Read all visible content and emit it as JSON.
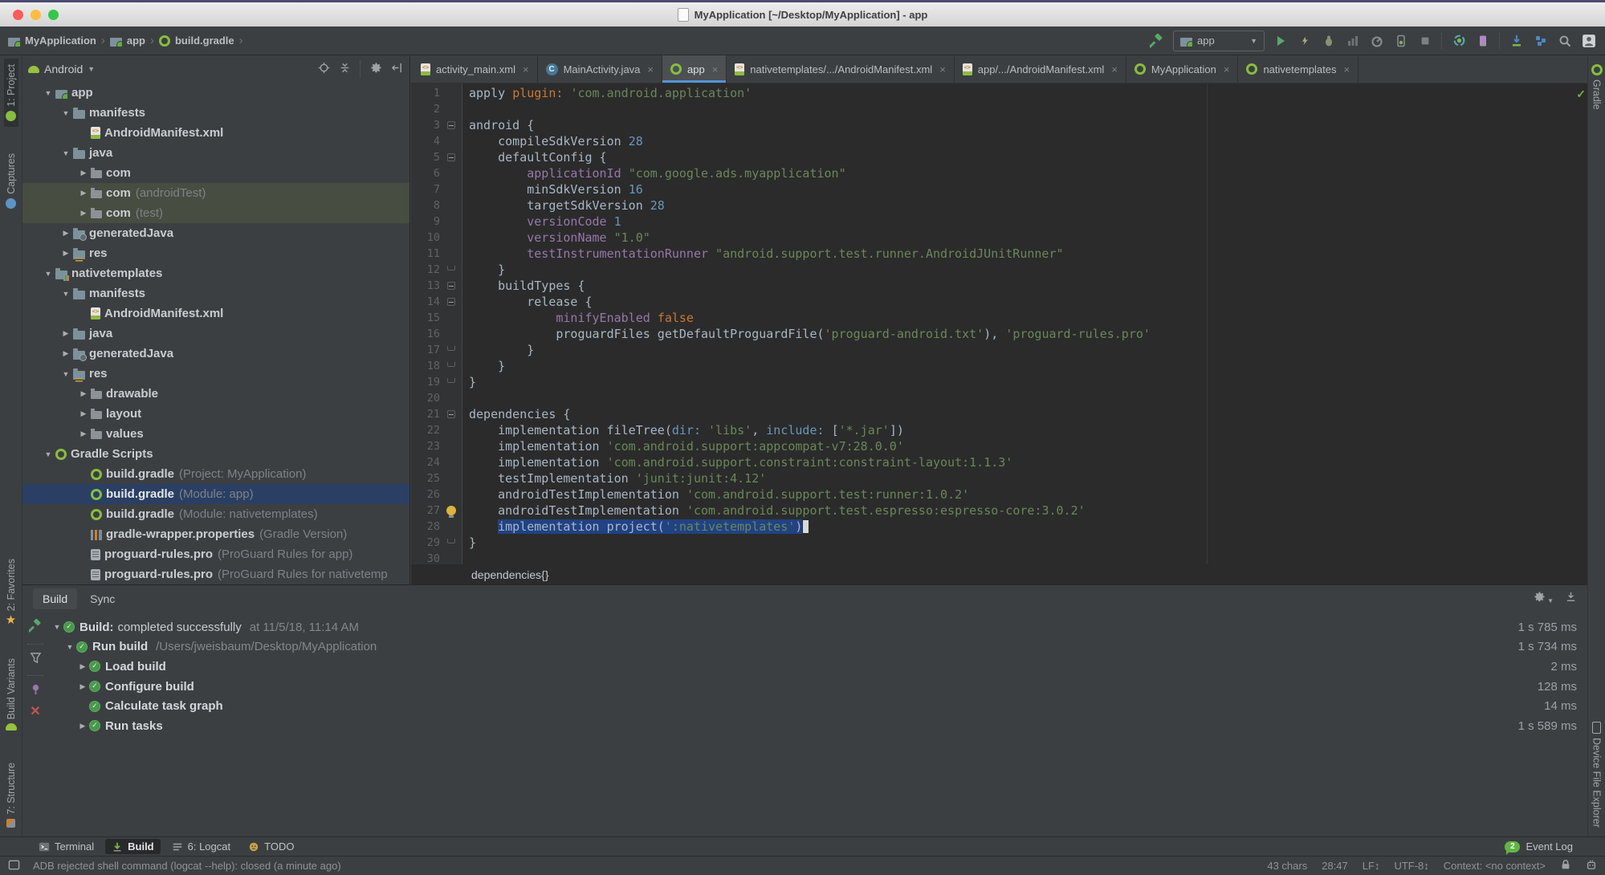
{
  "palette": {
    "chrome": "#3c3f41",
    "editor_bg": "#2b2b2b",
    "selection": "#214283",
    "tree_selection": "#2a3f63",
    "tab_underline": "#5394d6",
    "run_green": "#59a869",
    "gradle_green": "#87bd40",
    "error_red": "#c75450",
    "string_green": "#6a8759",
    "number_blue": "#6897bb",
    "keyword_orange": "#cc7832",
    "ident_purple": "#9876aa",
    "badge_green": "#62b543",
    "star_yellow": "#e8b64c"
  },
  "window": {
    "title": "MyApplication [~/Desktop/MyApplication] - app"
  },
  "breadcrumbs": [
    {
      "label": "MyApplication",
      "icon": "folder-icon"
    },
    {
      "label": "app",
      "icon": "module-folder-icon"
    },
    {
      "label": "build.gradle",
      "icon": "gradle-icon"
    }
  ],
  "toolbar": {
    "run_config": "app"
  },
  "stripes": {
    "left_top": [
      {
        "label": "1: Project",
        "icon": "project-icon"
      },
      {
        "label": "Captures",
        "icon": "captures-icon"
      }
    ],
    "left_bottom": [
      {
        "label": "2: Favorites",
        "icon": "star-icon"
      },
      {
        "label": "Build Variants",
        "icon": "android-icon"
      },
      {
        "label": "7: Structure",
        "icon": "structure-icon"
      }
    ],
    "right_top": {
      "label": "Gradle",
      "icon": "gradle-icon"
    },
    "right_bottom": {
      "label": "Device File Explorer",
      "icon": "phone-icon"
    }
  },
  "project": {
    "view": "Android",
    "tree": [
      {
        "d": 0,
        "a": "v",
        "i": "folder-app",
        "l": "app"
      },
      {
        "d": 1,
        "a": "v",
        "i": "folder",
        "l": "manifests"
      },
      {
        "d": 2,
        "a": "",
        "i": "manifest",
        "l": "AndroidManifest.xml"
      },
      {
        "d": 1,
        "a": "v",
        "i": "folder",
        "l": "java"
      },
      {
        "d": 2,
        "a": ">",
        "i": "pkg",
        "l": "com"
      },
      {
        "d": 2,
        "a": ">",
        "i": "pkg",
        "l": "com",
        "s": "(androidTest)",
        "hl": "soft"
      },
      {
        "d": 2,
        "a": ">",
        "i": "pkg",
        "l": "com",
        "s": "(test)",
        "hl": "soft"
      },
      {
        "d": 1,
        "a": ">",
        "i": "folder-gen",
        "l": "generatedJava"
      },
      {
        "d": 1,
        "a": ">",
        "i": "folder-res",
        "l": "res"
      },
      {
        "d": 0,
        "a": "v",
        "i": "folder-mod",
        "l": "nativetemplates"
      },
      {
        "d": 1,
        "a": "v",
        "i": "folder",
        "l": "manifests"
      },
      {
        "d": 2,
        "a": "",
        "i": "manifest",
        "l": "AndroidManifest.xml"
      },
      {
        "d": 1,
        "a": ">",
        "i": "folder",
        "l": "java"
      },
      {
        "d": 1,
        "a": ">",
        "i": "folder-gen",
        "l": "generatedJava"
      },
      {
        "d": 1,
        "a": "v",
        "i": "folder-res",
        "l": "res"
      },
      {
        "d": 2,
        "a": ">",
        "i": "pkg",
        "l": "drawable"
      },
      {
        "d": 2,
        "a": ">",
        "i": "pkg",
        "l": "layout"
      },
      {
        "d": 2,
        "a": ">",
        "i": "pkg",
        "l": "values"
      },
      {
        "d": 0,
        "a": "v",
        "i": "gradle",
        "l": "Gradle Scripts"
      },
      {
        "d": 2,
        "a": "",
        "i": "gradle",
        "l": "build.gradle",
        "s": "(Project: MyApplication)"
      },
      {
        "d": 2,
        "a": "",
        "i": "gradle",
        "l": "build.gradle",
        "s": "(Module: app)",
        "hl": "sel"
      },
      {
        "d": 2,
        "a": "",
        "i": "gradle",
        "l": "build.gradle",
        "s": "(Module: nativetemplates)"
      },
      {
        "d": 2,
        "a": "",
        "i": "props",
        "l": "gradle-wrapper.properties",
        "s": "(Gradle Version)"
      },
      {
        "d": 2,
        "a": "",
        "i": "file",
        "l": "proguard-rules.pro",
        "s": "(ProGuard Rules for app)"
      },
      {
        "d": 2,
        "a": "",
        "i": "file",
        "l": "proguard-rules.pro",
        "s": "(ProGuard Rules for nativetemp"
      }
    ]
  },
  "editor": {
    "tabs": [
      {
        "label": "activity_main.xml",
        "icon": "xml-file-icon"
      },
      {
        "label": "MainActivity.java",
        "icon": "class-icon"
      },
      {
        "label": "app",
        "icon": "gradle-icon",
        "selected": true
      },
      {
        "label": "nativetemplates/.../AndroidManifest.xml",
        "icon": "manifest-icon"
      },
      {
        "label": "app/.../AndroidManifest.xml",
        "icon": "manifest-icon"
      },
      {
        "label": "MyApplication",
        "icon": "gradle-icon"
      },
      {
        "label": "nativetemplates",
        "icon": "gradle-icon"
      }
    ],
    "bottom_breadcrumb": "dependencies{}",
    "lines": [
      {
        "tok": [
          [
            "apply ",
            "tp"
          ],
          [
            "plugin: ",
            "to"
          ],
          [
            "'com.android.application'",
            "ts"
          ]
        ]
      },
      {
        "tok": []
      },
      {
        "tok": [
          [
            "android {",
            "tp"
          ]
        ],
        "fold": "s"
      },
      {
        "tok": [
          [
            "    compileSdkVersion ",
            "tp"
          ],
          [
            "28",
            "tn"
          ]
        ]
      },
      {
        "tok": [
          [
            "    defaultConfig {",
            "tp"
          ]
        ],
        "fold": "s"
      },
      {
        "tok": [
          [
            "        applicationId ",
            "tu"
          ],
          [
            "\"com.google.ads.myapplication\"",
            "ts"
          ]
        ]
      },
      {
        "tok": [
          [
            "        minSdkVersion ",
            "tp"
          ],
          [
            "16",
            "tn"
          ]
        ]
      },
      {
        "tok": [
          [
            "        targetSdkVersion ",
            "tp"
          ],
          [
            "28",
            "tn"
          ]
        ]
      },
      {
        "tok": [
          [
            "        versionCode ",
            "tu"
          ],
          [
            "1",
            "tn"
          ]
        ]
      },
      {
        "tok": [
          [
            "        versionName ",
            "tu"
          ],
          [
            "\"1.0\"",
            "ts"
          ]
        ]
      },
      {
        "tok": [
          [
            "        testInstrumentationRunner ",
            "tu"
          ],
          [
            "\"android.support.test.runner.AndroidJUnitRunner\"",
            "ts"
          ]
        ]
      },
      {
        "tok": [
          [
            "    }",
            "tp"
          ]
        ],
        "fold": "e"
      },
      {
        "tok": [
          [
            "    buildTypes {",
            "tp"
          ]
        ],
        "fold": "s"
      },
      {
        "tok": [
          [
            "        release {",
            "tp"
          ]
        ],
        "fold": "s"
      },
      {
        "tok": [
          [
            "            minifyEnabled ",
            "tu"
          ],
          [
            "false",
            "to"
          ]
        ]
      },
      {
        "tok": [
          [
            "            proguardFiles getDefaultProguardFile(",
            "tp"
          ],
          [
            "'proguard-android.txt'",
            "ts"
          ],
          [
            "), ",
            "tp"
          ],
          [
            "'proguard-rules.pro'",
            "ts"
          ]
        ]
      },
      {
        "tok": [
          [
            "        }",
            "tp"
          ]
        ],
        "fold": "e"
      },
      {
        "tok": [
          [
            "    }",
            "tp"
          ]
        ],
        "fold": "e"
      },
      {
        "tok": [
          [
            "}",
            "tp"
          ]
        ],
        "fold": "e"
      },
      {
        "tok": []
      },
      {
        "tok": [
          [
            "dependencies {",
            "tp"
          ]
        ],
        "fold": "s"
      },
      {
        "tok": [
          [
            "    implementation fileTree(",
            "tp"
          ],
          [
            "dir: ",
            "tb"
          ],
          [
            "'libs'",
            "ts"
          ],
          [
            ", ",
            "tp"
          ],
          [
            "include: ",
            "tb"
          ],
          [
            "[",
            "tp"
          ],
          [
            "'*.jar'",
            "ts"
          ],
          [
            "])",
            "tp"
          ]
        ]
      },
      {
        "tok": [
          [
            "    implementation ",
            "tp"
          ],
          [
            "'com.android.support:appcompat-v7:28.0.0'",
            "ts"
          ]
        ]
      },
      {
        "tok": [
          [
            "    implementation ",
            "tp"
          ],
          [
            "'com.android.support.constraint:constraint-layout:1.1.3'",
            "ts"
          ]
        ]
      },
      {
        "tok": [
          [
            "    testImplementation ",
            "tp"
          ],
          [
            "'junit:junit:4.12'",
            "ts"
          ]
        ]
      },
      {
        "tok": [
          [
            "    androidTestImplementation ",
            "tp"
          ],
          [
            "'com.android.support.test:runner:1.0.2'",
            "ts"
          ]
        ]
      },
      {
        "tok": [
          [
            "    androidTestImplementation ",
            "tp"
          ],
          [
            "'com.android.support.test.espresso:espresso-core:3.0.2'",
            "ts"
          ]
        ],
        "bulb": true
      },
      {
        "tok": [
          [
            "    ",
            "tp"
          ],
          [
            "implementation project(",
            "tp",
            "sel"
          ],
          [
            "':nativetemplates'",
            "ts",
            "sel"
          ],
          [
            ")",
            "tp",
            "sel"
          ]
        ],
        "cursor": true
      },
      {
        "tok": [
          [
            "}",
            "tp"
          ]
        ],
        "fold": "e"
      },
      {
        "tok": []
      }
    ]
  },
  "build": {
    "tabs": [
      "Build",
      "Sync"
    ],
    "selected_tab": "Build",
    "tree": [
      {
        "indent": 0,
        "arrow": "v",
        "label": "Build:",
        "label2": "completed successfully",
        "detail": "at 11/5/18, 11:14 AM",
        "time": "1 s 785 ms"
      },
      {
        "indent": 1,
        "arrow": "v",
        "label": "Run build",
        "label2": "",
        "detail": "/Users/jweisbaum/Desktop/MyApplication",
        "time": "1 s 734 ms"
      },
      {
        "indent": 2,
        "arrow": ">",
        "label": "Load build",
        "label2": "",
        "detail": "",
        "time": "2 ms"
      },
      {
        "indent": 2,
        "arrow": ">",
        "label": "Configure build",
        "label2": "",
        "detail": "",
        "time": "128 ms"
      },
      {
        "indent": 2,
        "arrow": "",
        "label": "Calculate task graph",
        "label2": "",
        "detail": "",
        "time": "14 ms"
      },
      {
        "indent": 2,
        "arrow": ">",
        "label": "Run tasks",
        "label2": "",
        "detail": "",
        "time": "1 s 589 ms"
      }
    ]
  },
  "bottom_bar": {
    "items": [
      {
        "label": "Terminal",
        "icon": "terminal-icon",
        "selected": false
      },
      {
        "label": "Build",
        "icon": "build-arrow-icon",
        "selected": true
      },
      {
        "label": "6: Logcat",
        "icon": "list-icon",
        "selected": false
      },
      {
        "label": "TODO",
        "icon": "todo-icon",
        "selected": false
      }
    ],
    "event_log": {
      "badge": "2",
      "label": "Event Log"
    }
  },
  "status_bar": {
    "message": "ADB rejected shell command (logcat --help): closed (a minute ago)",
    "chars": "43 chars",
    "position": "28:47",
    "line_ending": "LF",
    "encoding": "UTF-8",
    "context": "Context: <no context>"
  }
}
